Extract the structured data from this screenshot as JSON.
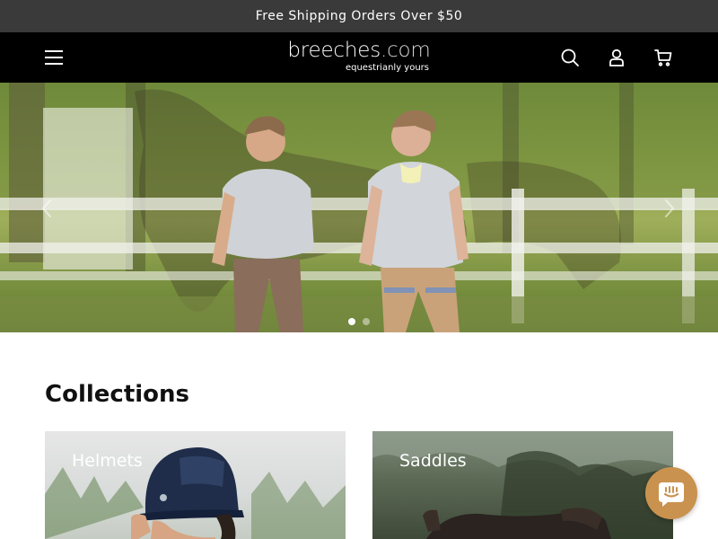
{
  "announcement": {
    "text": "Free Shipping Orders Over $50"
  },
  "header": {
    "menu_icon": "hamburger-menu-icon",
    "logo": {
      "main": "breeches",
      "tld": ".com",
      "tagline": "equestrianly yours"
    },
    "icons": [
      "search-icon",
      "account-icon",
      "cart-icon"
    ]
  },
  "hero": {
    "slides_count": 2,
    "active_slide": 1,
    "prev_icon": "chevron-left-icon",
    "next_icon": "chevron-right-icon"
  },
  "collections": {
    "title": "Collections",
    "items": [
      {
        "label": "Helmets"
      },
      {
        "label": "Saddles"
      }
    ]
  },
  "chat": {
    "icon": "chat-bubble-icon"
  },
  "colors": {
    "announcement_bg": "#3a3a3a",
    "header_bg": "#000000",
    "chat_accent": "#c9924e"
  }
}
